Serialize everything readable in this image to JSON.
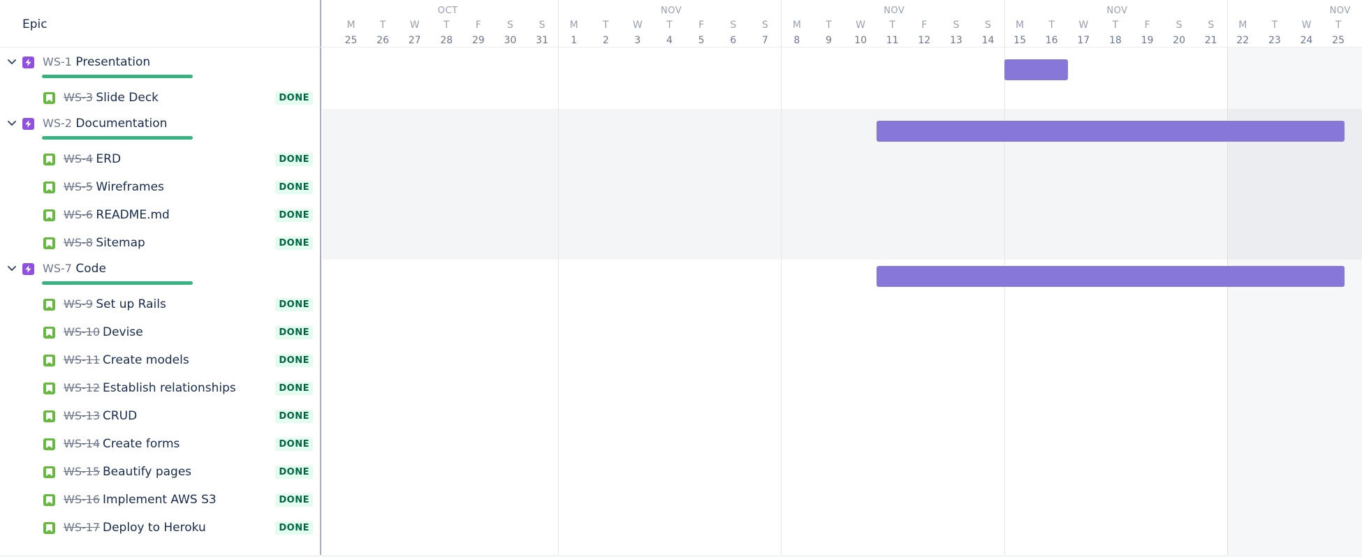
{
  "header": {
    "title": "Epic"
  },
  "timeline": {
    "weeks": [
      {
        "month": "OCT",
        "days": [
          [
            "M",
            "25"
          ],
          [
            "T",
            "26"
          ],
          [
            "W",
            "27"
          ],
          [
            "T",
            "28"
          ],
          [
            "F",
            "29"
          ],
          [
            "S",
            "30"
          ],
          [
            "S",
            "31"
          ]
        ]
      },
      {
        "month": "NOV",
        "days": [
          [
            "M",
            "1"
          ],
          [
            "T",
            "2"
          ],
          [
            "W",
            "3"
          ],
          [
            "T",
            "4"
          ],
          [
            "F",
            "5"
          ],
          [
            "S",
            "6"
          ],
          [
            "S",
            "7"
          ]
        ]
      },
      {
        "month": "NOV",
        "days": [
          [
            "M",
            "8"
          ],
          [
            "T",
            "9"
          ],
          [
            "W",
            "10"
          ],
          [
            "T",
            "11"
          ],
          [
            "F",
            "12"
          ],
          [
            "S",
            "13"
          ],
          [
            "S",
            "14"
          ]
        ]
      },
      {
        "month": "NOV",
        "days": [
          [
            "M",
            "15"
          ],
          [
            "T",
            "16"
          ],
          [
            "W",
            "17"
          ],
          [
            "T",
            "18"
          ],
          [
            "F",
            "19"
          ],
          [
            "S",
            "20"
          ],
          [
            "S",
            "21"
          ]
        ]
      },
      {
        "month": "NOV",
        "days": [
          [
            "M",
            "22"
          ],
          [
            "T",
            "23"
          ],
          [
            "W",
            "24"
          ],
          [
            "T",
            "25"
          ]
        ]
      }
    ]
  },
  "epics": [
    {
      "key": "WS-1",
      "summary": "Presentation",
      "children": [
        {
          "key": "WS-3",
          "summary": "Slide Deck",
          "status": "DONE"
        }
      ]
    },
    {
      "key": "WS-2",
      "summary": "Documentation",
      "children": [
        {
          "key": "WS-4",
          "summary": "ERD",
          "status": "DONE"
        },
        {
          "key": "WS-5",
          "summary": "Wireframes",
          "status": "DONE"
        },
        {
          "key": "WS-6",
          "summary": "README.md",
          "status": "DONE"
        },
        {
          "key": "WS-8",
          "summary": "Sitemap",
          "status": "DONE"
        }
      ]
    },
    {
      "key": "WS-7",
      "summary": "Code",
      "children": [
        {
          "key": "WS-9",
          "summary": "Set up Rails",
          "status": "DONE"
        },
        {
          "key": "WS-10",
          "summary": "Devise",
          "status": "DONE"
        },
        {
          "key": "WS-11",
          "summary": "Create models",
          "status": "DONE"
        },
        {
          "key": "WS-12",
          "summary": "Establish relationships",
          "status": "DONE"
        },
        {
          "key": "WS-13",
          "summary": "CRUD",
          "status": "DONE"
        },
        {
          "key": "WS-14",
          "summary": "Create forms",
          "status": "DONE"
        },
        {
          "key": "WS-15",
          "summary": "Beautify pages",
          "status": "DONE"
        },
        {
          "key": "WS-16",
          "summary": "Implement AWS S3",
          "status": "DONE"
        },
        {
          "key": "WS-17",
          "summary": "Deploy to Heroku",
          "status": "DONE"
        }
      ]
    }
  ],
  "colors": {
    "epic_icon": "#904ee2",
    "story_icon": "#63ba3c",
    "progress": "#36b37e",
    "bar": "#8777d9",
    "status_bg": "#e3fcef",
    "status_text": "#006644"
  }
}
